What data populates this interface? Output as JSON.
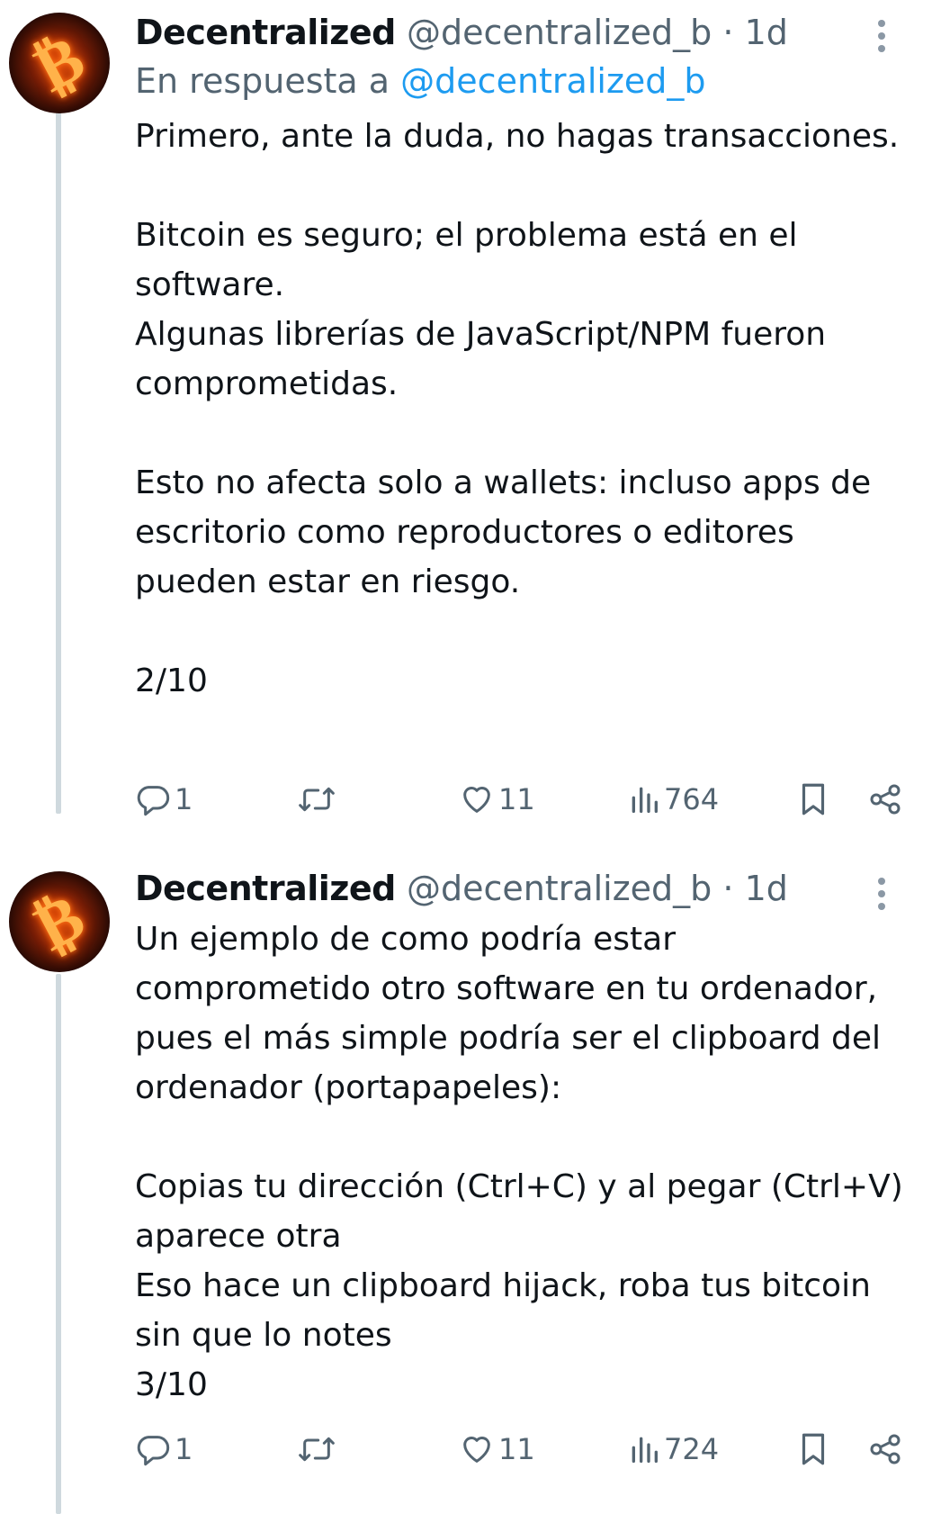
{
  "tweets": [
    {
      "author": "Decentralized",
      "handle": "@decentralized_b",
      "dot": "·",
      "time": "1d",
      "reply_prefix": "En respuesta a",
      "reply_mention": "@decentralized_b",
      "paragraphs": [
        "Primero, ante la duda, no hagas transacciones.",
        "",
        "Bitcoin es seguro; el problema está en el software.",
        "Algunas librerías de JavaScript/NPM fueron comprometidas.",
        "",
        "Esto no afecta solo a wallets: incluso apps de escritorio como reproductores o editores pueden estar en riesgo.",
        "",
        "2/10"
      ],
      "replies": "1",
      "likes": "11",
      "views": "764",
      "icons": [
        "reply-icon",
        "retweet-icon",
        "like-icon",
        "views-icon",
        "bookmark-icon",
        "share-icon"
      ]
    },
    {
      "author": "Decentralized",
      "handle": "@decentralized_b",
      "dot": "·",
      "time": "1d",
      "paragraphs": [
        "Un ejemplo de como podría estar comprometido otro software en tu ordenador, pues el más simple podría ser el clipboard del ordenador (portapapeles):",
        "",
        "Copias tu dirección (Ctrl+C) y al pegar (Ctrl+V) aparece otra",
        "Eso hace un clipboard hijack, roba tus bitcoin sin que lo notes",
        "3/10"
      ],
      "replies": "1",
      "likes": "11",
      "views": "724",
      "icons": [
        "reply-icon",
        "retweet-icon",
        "like-icon",
        "views-icon",
        "bookmark-icon",
        "share-icon"
      ]
    }
  ],
  "colors": {
    "text": "#0f1419",
    "secondary": "#536471",
    "mention": "#1d9bf0",
    "thread_line": "#cfd9de"
  }
}
